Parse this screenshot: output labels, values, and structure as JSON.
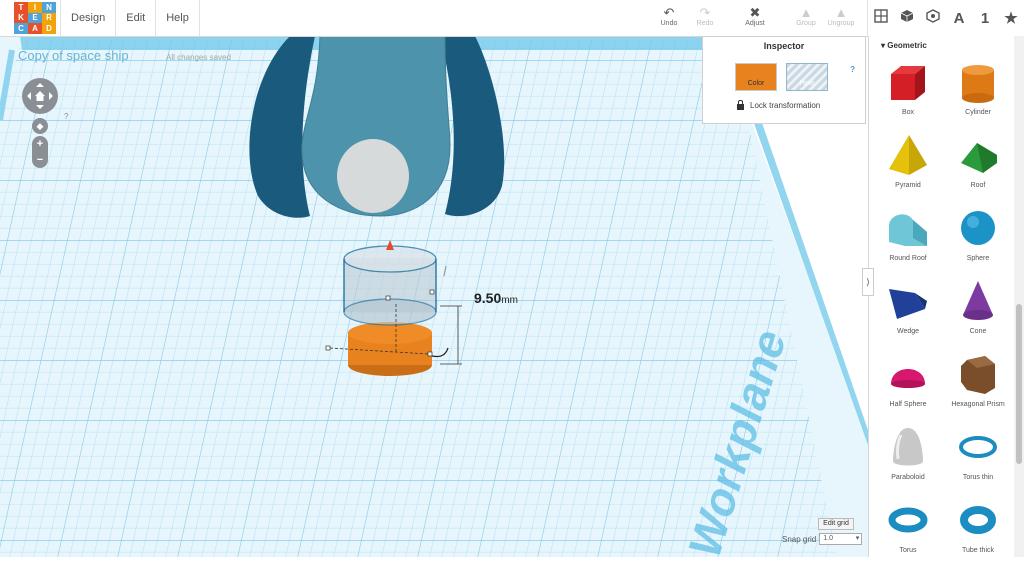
{
  "app": {
    "logo_letters": [
      "T",
      "I",
      "N",
      "K",
      "E",
      "R",
      "C",
      "A",
      "D"
    ],
    "logo_colors": [
      "#e6512c",
      "#f0a30a",
      "#4fa3d8",
      "#e6512c",
      "#4fa3d8",
      "#f0a30a",
      "#4fa3d8",
      "#e6512c",
      "#f0a30a"
    ]
  },
  "menu": {
    "design": "Design",
    "edit": "Edit",
    "help": "Help"
  },
  "toolbar": {
    "undo": "Undo",
    "redo": "Redo",
    "adjust": "Adjust",
    "group": "Group",
    "ungroup": "Ungroup",
    "view_text_icon_label": "A",
    "view_number_label": "1"
  },
  "document": {
    "title": "Copy of space ship",
    "save_status": "All changes saved",
    "help_mark": "?"
  },
  "measurement": {
    "value": "9.50",
    "unit": "mm"
  },
  "workplane": {
    "label": "Workplane"
  },
  "grid": {
    "edit_label": "Edit grid",
    "snap_label": "Snap grid",
    "snap_value": "1.0"
  },
  "inspector": {
    "title": "Inspector",
    "color_label": "Color",
    "hole_label": "Hole",
    "help_mark": "?",
    "lock_label": "Lock transformation",
    "color_value": "#e8821e"
  },
  "sidebar": {
    "category": "Geometric",
    "shapes": [
      {
        "label": "Box",
        "icon": "box-icon"
      },
      {
        "label": "Cylinder",
        "icon": "cylinder-icon"
      },
      {
        "label": "Pyramid",
        "icon": "pyramid-icon"
      },
      {
        "label": "Roof",
        "icon": "roof-icon"
      },
      {
        "label": "Round Roof",
        "icon": "round-roof-icon"
      },
      {
        "label": "Sphere",
        "icon": "sphere-icon"
      },
      {
        "label": "Wedge",
        "icon": "wedge-icon"
      },
      {
        "label": "Cone",
        "icon": "cone-icon"
      },
      {
        "label": "Half Sphere",
        "icon": "half-sphere-icon"
      },
      {
        "label": "Hexagonal Prism",
        "icon": "hexagonal-prism-icon"
      },
      {
        "label": "Paraboloid",
        "icon": "paraboloid-icon"
      },
      {
        "label": "Torus thin",
        "icon": "torus-thin-icon"
      },
      {
        "label": "Torus",
        "icon": "torus-icon"
      },
      {
        "label": "Tube thick",
        "icon": "tube-icon"
      }
    ]
  },
  "colors": {
    "accent": "#64b5d3",
    "grid": "#8fd0ea",
    "workplane_frame": "#59bfe6",
    "shape_orange": "#e8821e"
  }
}
